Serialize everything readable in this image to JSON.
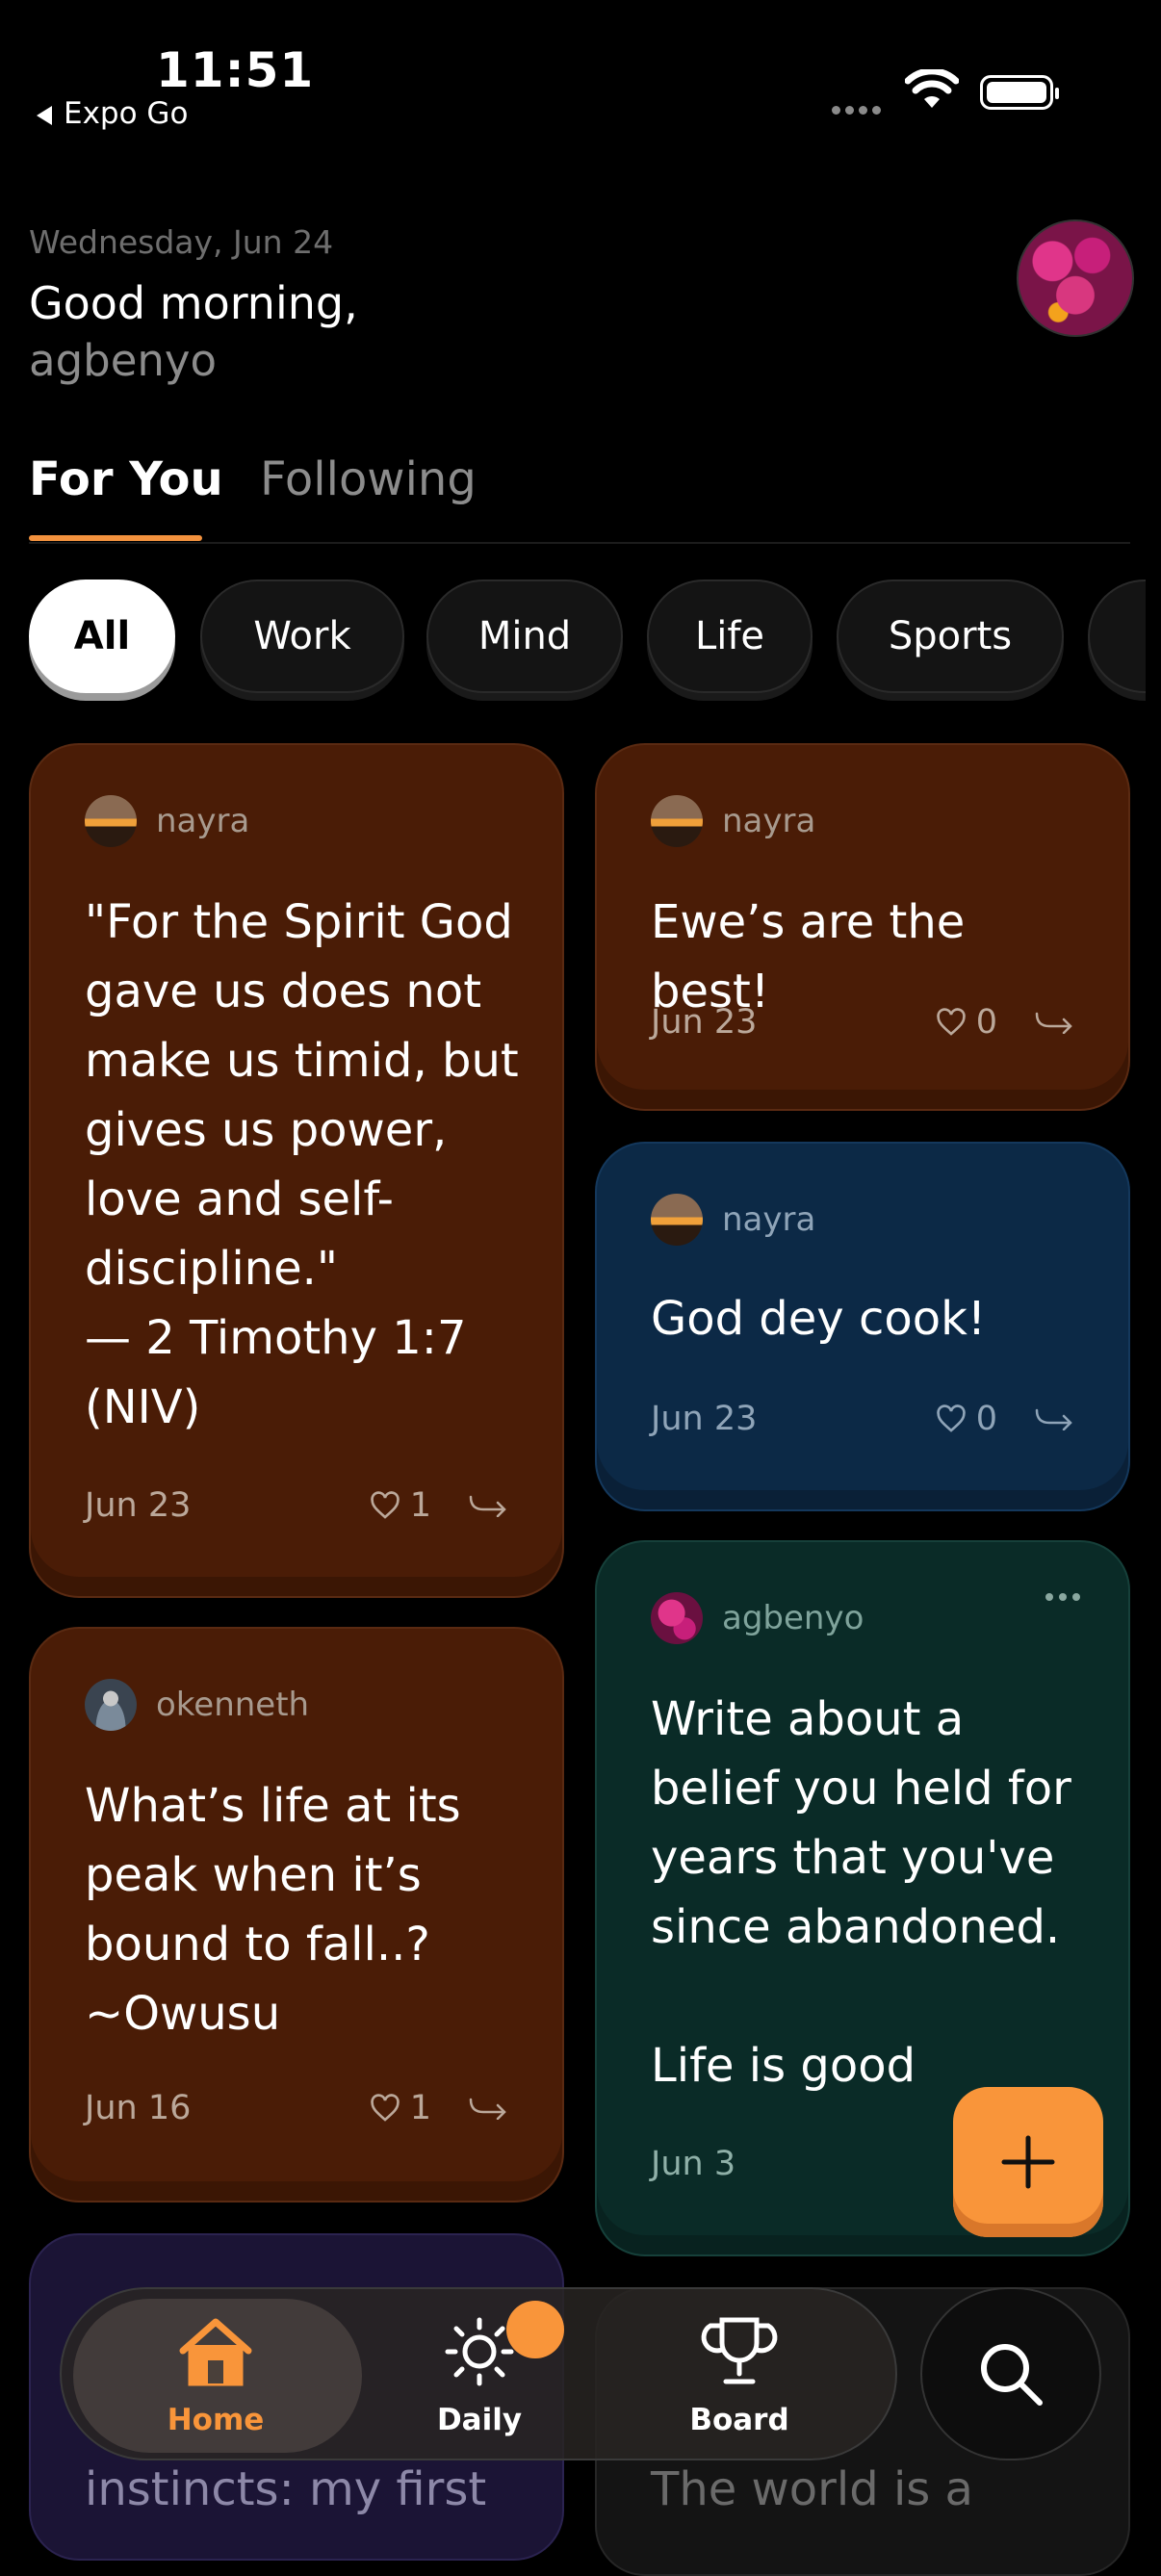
{
  "status_bar": {
    "time": "11:51",
    "back_label": "Expo Go"
  },
  "header": {
    "date": "Wednesday, Jun 24",
    "greeting": "Good morning,",
    "username": "agbenyo"
  },
  "tabs": [
    {
      "label": "For You",
      "active": true
    },
    {
      "label": "Following",
      "active": false
    }
  ],
  "chips": [
    {
      "label": "All",
      "active": true
    },
    {
      "label": "Work"
    },
    {
      "label": "Mind"
    },
    {
      "label": "Life"
    },
    {
      "label": "Sports"
    }
  ],
  "cards": [
    {
      "author": "nayra",
      "text": "\"For the Spirit God\ngave us does not\nmake us timid, but\ngives us power,\nlove and self-\ndiscipline.\"\n— 2 Timothy 1:7\n(NIV)",
      "date": "Jun 23",
      "likes": "1"
    },
    {
      "author": "nayra",
      "text": "Ewe’s are the best!",
      "date": "Jun 23",
      "likes": "0"
    },
    {
      "author": "nayra",
      "text": "God dey cook!",
      "date": "Jun 23",
      "likes": "0"
    },
    {
      "author": "agbenyo",
      "text": "Write about a\nbelief you held for\nyears that you've\nsince abandoned.\n\nLife is good",
      "date": "Jun 3"
    },
    {
      "author": "okenneth",
      "text": "What’s life at its\npeak when it’s\nbound to fall..?\n~Owusu",
      "date": "Jun 16",
      "likes": "1"
    },
    {
      "text": "instincts: my first"
    },
    {
      "text": "The world is a"
    }
  ],
  "nav": [
    {
      "label": "Home",
      "active": true
    },
    {
      "label": "Daily"
    },
    {
      "label": "Board"
    }
  ],
  "colors": {
    "accent": "#f9953a",
    "brown_card": "#4a1c06",
    "blue_card": "#0c2946",
    "teal_card": "#0a2b27"
  }
}
